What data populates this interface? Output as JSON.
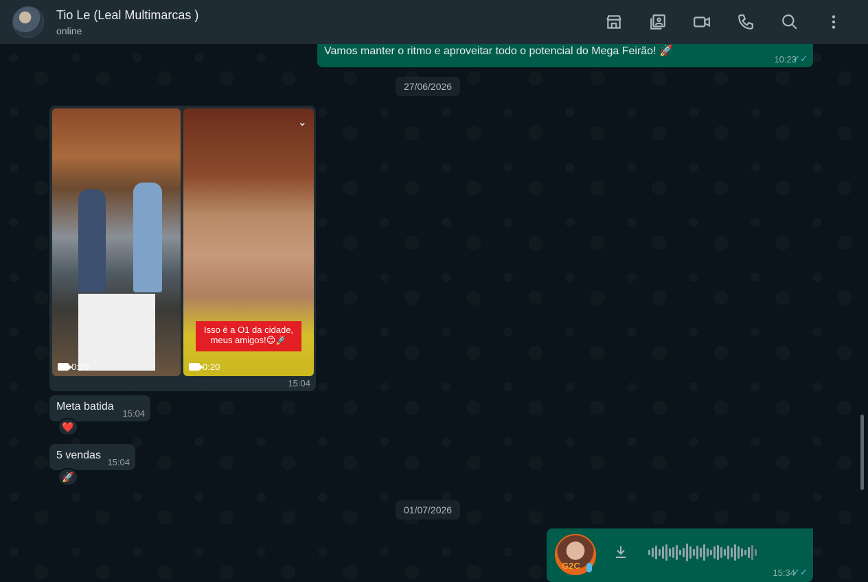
{
  "header": {
    "contact_name": "Tio Le (Leal Multimarcas )",
    "status": "online",
    "icons": [
      "store-icon",
      "media-gallery-icon",
      "video-call-icon",
      "voice-call-icon",
      "search-icon",
      "menu-icon"
    ]
  },
  "messages": {
    "top_out": {
      "text": "Vamos manter o ritmo e aproveitar todo o potencial do Mega Feirão! 🚀",
      "time": "10:23"
    },
    "date1": "27/06/2026",
    "media": {
      "video1_duration": "0:20",
      "video2_duration": "0:20",
      "video2_caption": "Isso é a O1 da cidade, meus amigos!😊🚀",
      "time": "15:04"
    },
    "meta": {
      "text": "Meta batida",
      "time": "15:04",
      "reaction": "❤️"
    },
    "vendas": {
      "text": "5 vendas",
      "time": "15:04",
      "reaction": "🚀"
    },
    "date2": "01/07/2026",
    "audio": {
      "time": "15:34",
      "avatar_text": "G2C"
    }
  },
  "colors": {
    "header_bg": "#202c33",
    "chat_bg": "#0b141a",
    "outgoing": "#005c4b",
    "incoming": "#202c33",
    "tick": "#53bdeb"
  }
}
